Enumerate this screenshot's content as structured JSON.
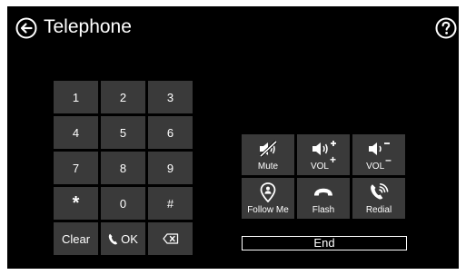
{
  "header": {
    "title": "Telephone",
    "back_icon": "back-arrow-circle-icon",
    "help_icon": "help-question-circle-icon"
  },
  "keypad": {
    "keys": [
      "1",
      "2",
      "3",
      "4",
      "5",
      "6",
      "7",
      "8",
      "9",
      "*",
      "0",
      "#"
    ],
    "clear_label": "Clear",
    "ok_label": "OK",
    "ok_icon": "phone-handset-icon",
    "backspace_icon": "backspace-icon"
  },
  "controls": {
    "mute_label": "Mute",
    "vol_up_label": "VOL",
    "vol_up_sign": "+",
    "vol_down_label": "VOL",
    "vol_down_sign": "–",
    "follow_me_label": "Follow Me",
    "flash_label": "Flash",
    "redial_label": "Redial"
  },
  "end_label": "End",
  "colors": {
    "background": "#000000",
    "button": "#3a3a3a",
    "text": "#ffffff"
  }
}
